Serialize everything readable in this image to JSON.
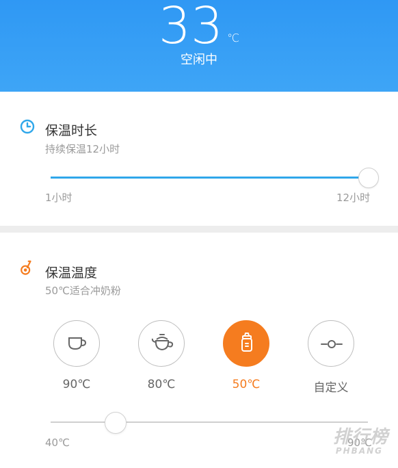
{
  "header": {
    "temperature": "33",
    "unit": "℃",
    "status": "空闲中"
  },
  "keep_warm_duration": {
    "title": "保温时长",
    "subtitle": "持续保温12小时",
    "min_label": "1小时",
    "max_label": "12小时",
    "value_hours": 12,
    "icon": "clock-icon"
  },
  "keep_warm_temperature": {
    "title": "保温温度",
    "subtitle": "50℃适合冲奶粉",
    "icon": "thermometer-icon",
    "modes": [
      {
        "label": "90℃",
        "icon": "cup-icon",
        "active": false
      },
      {
        "label": "80℃",
        "icon": "teapot-icon",
        "active": false
      },
      {
        "label": "50℃",
        "icon": "baby-bottle-icon",
        "active": true
      },
      {
        "label": "自定义",
        "icon": "custom-slider-icon",
        "active": false
      }
    ],
    "slider_min_label": "40℃",
    "slider_max_label": "90℃",
    "slider_value": 50
  },
  "watermark": {
    "text": "排行榜",
    "sub": "PHBANG"
  },
  "colors": {
    "header_blue": "#3ea5f6",
    "accent_orange": "#f57c1f",
    "slider_blue": "#2fa7ea"
  }
}
